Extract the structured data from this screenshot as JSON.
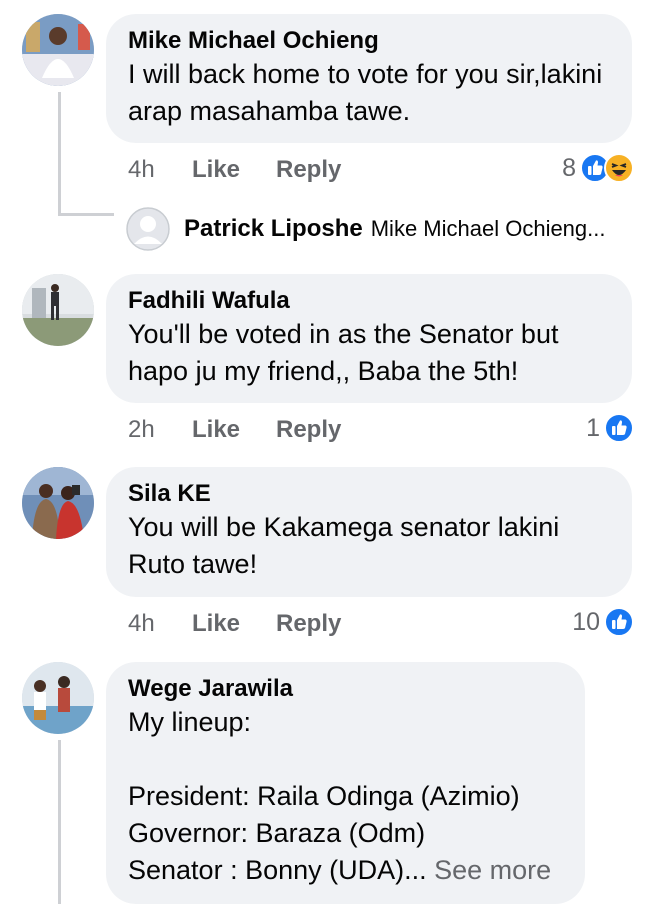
{
  "comments": [
    {
      "author": "Mike Michael Ochieng",
      "text": "I will back home to vote for you sir,lakini arap masahamba tawe.",
      "time": "4h",
      "like_label": "Like",
      "reply_label": "Reply",
      "reaction_count": "8",
      "reactions": [
        "like-reaction-icon",
        "haha-reaction-icon"
      ]
    },
    {
      "author": "Fadhili Wafula",
      "text": "You'll be voted in as the Senator but hapo ju my friend,, Baba the 5th!",
      "time": "2h",
      "like_label": "Like",
      "reply_label": "Reply",
      "reaction_count": "1",
      "reactions": [
        "like-reaction-icon"
      ]
    },
    {
      "author": "Sila KE",
      "text": "You will be Kakamega senator lakini Ruto tawe!",
      "time": "4h",
      "like_label": "Like",
      "reply_label": "Reply",
      "reaction_count": "10",
      "reactions": [
        "like-reaction-icon"
      ]
    },
    {
      "author": "Wege Jarawila",
      "text": "My lineup:\n\nPresident: Raila Odinga (Azimio)\nGovernor: Baraza (Odm)\nSenator : Bonny (UDA)...",
      "see_more": " See more"
    }
  ],
  "reply_preview": {
    "author": "Patrick Liposhe",
    "snippet": "Mike Michael Ochieng..."
  },
  "colors": {
    "bubble": "#f0f2f5",
    "secondary_text": "#65676b",
    "like_blue": "#1877f2",
    "haha_yellow": "#f7b125",
    "thread_line": "#ced0d4"
  }
}
